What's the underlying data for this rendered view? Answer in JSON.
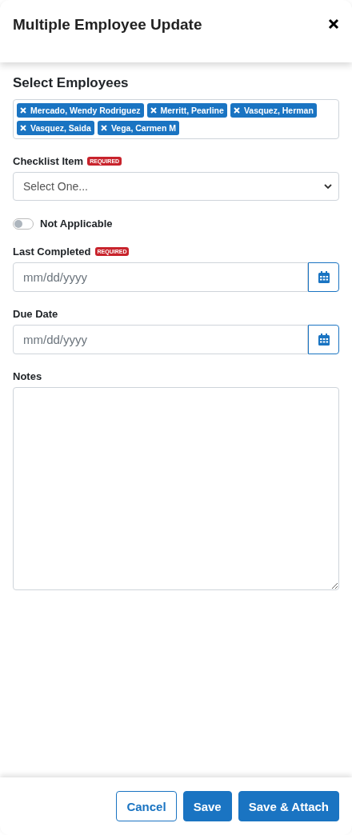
{
  "dialog": {
    "title": "Multiple Employee Update"
  },
  "employees": {
    "label": "Select Employees",
    "chips": [
      {
        "name": "Mercado, Wendy Rodriguez"
      },
      {
        "name": "Merritt, Pearline"
      },
      {
        "name": "Vasquez, Herman"
      },
      {
        "name": "Vasquez, Saida"
      },
      {
        "name": "Vega, Carmen M"
      }
    ]
  },
  "checklist_item": {
    "label": "Checklist Item",
    "badge": "REQUIRED",
    "placeholder": "Select One..."
  },
  "not_applicable": {
    "label": "Not Applicable",
    "on": false
  },
  "last_completed": {
    "label": "Last Completed",
    "badge": "REQUIRED",
    "placeholder": "mm/dd/yyyy"
  },
  "due_date": {
    "label": "Due Date",
    "placeholder": "mm/dd/yyyy"
  },
  "notes": {
    "label": "Notes"
  },
  "buttons": [
    {
      "label": "Cancel",
      "kind": "outline"
    },
    {
      "label": "Save",
      "kind": "primary"
    },
    {
      "label": "Save & Attach",
      "kind": "primary"
    }
  ]
}
